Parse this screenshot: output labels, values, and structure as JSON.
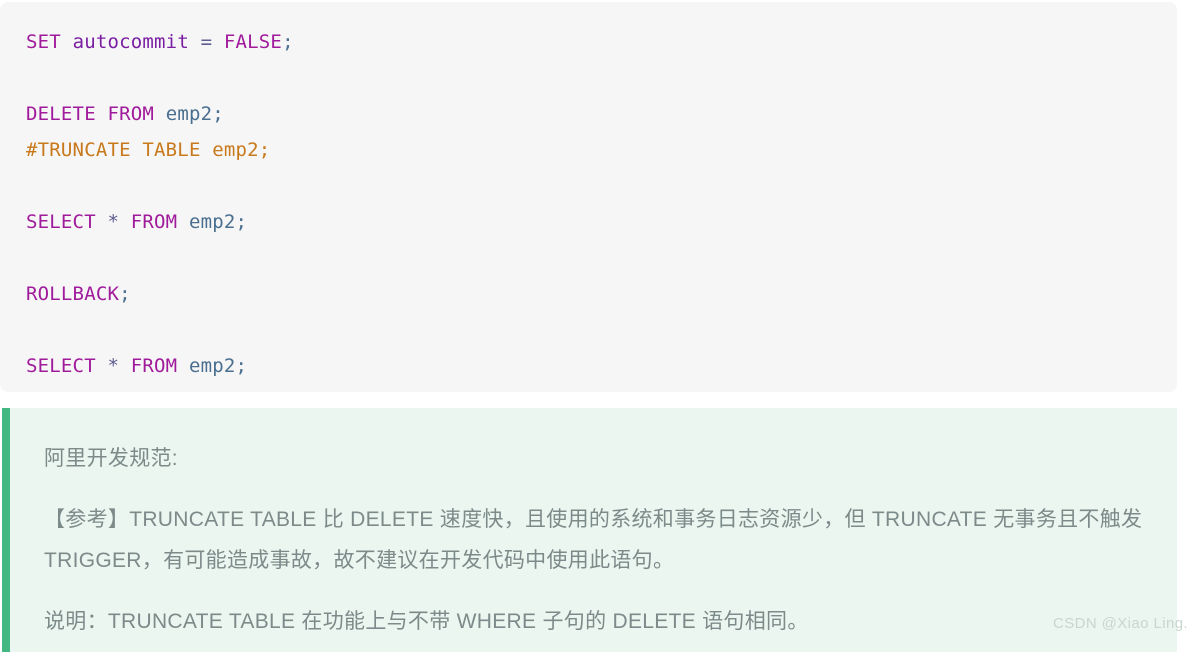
{
  "code_block": {
    "background": "#f6f6f6",
    "language": "sql",
    "lines": [
      {
        "type": "code",
        "tokens": [
          {
            "t": "SET",
            "c": "kw"
          },
          {
            "t": " ",
            "c": "plain"
          },
          {
            "t": "autocommit",
            "c": "kw2"
          },
          {
            "t": " ",
            "c": "plain"
          },
          {
            "t": "=",
            "c": "op"
          },
          {
            "t": " ",
            "c": "plain"
          },
          {
            "t": "FALSE",
            "c": "kw"
          },
          {
            "t": ";",
            "c": "punct"
          }
        ],
        "text": "SET autocommit = FALSE;"
      },
      {
        "type": "blank",
        "tokens": [],
        "text": ""
      },
      {
        "type": "code",
        "tokens": [
          {
            "t": "DELETE",
            "c": "kw"
          },
          {
            "t": " ",
            "c": "plain"
          },
          {
            "t": "FROM",
            "c": "kw"
          },
          {
            "t": " ",
            "c": "plain"
          },
          {
            "t": "emp2",
            "c": "ident"
          },
          {
            "t": ";",
            "c": "punct"
          }
        ],
        "text": "DELETE FROM emp2;"
      },
      {
        "type": "comment",
        "tokens": [
          {
            "t": "#TRUNCATE TABLE emp2;",
            "c": "comment"
          }
        ],
        "text": "#TRUNCATE TABLE emp2;"
      },
      {
        "type": "blank",
        "tokens": [],
        "text": ""
      },
      {
        "type": "code",
        "tokens": [
          {
            "t": "SELECT",
            "c": "kw"
          },
          {
            "t": " ",
            "c": "plain"
          },
          {
            "t": "*",
            "c": "op"
          },
          {
            "t": " ",
            "c": "plain"
          },
          {
            "t": "FROM",
            "c": "kw"
          },
          {
            "t": " ",
            "c": "plain"
          },
          {
            "t": "emp2",
            "c": "ident"
          },
          {
            "t": ";",
            "c": "punct"
          }
        ],
        "text": "SELECT * FROM emp2;"
      },
      {
        "type": "blank",
        "tokens": [],
        "text": ""
      },
      {
        "type": "code",
        "tokens": [
          {
            "t": "ROLLBACK",
            "c": "kw"
          },
          {
            "t": ";",
            "c": "punct"
          }
        ],
        "text": "ROLLBACK;"
      },
      {
        "type": "blank",
        "tokens": [],
        "text": ""
      },
      {
        "type": "code",
        "tokens": [
          {
            "t": "SELECT",
            "c": "kw"
          },
          {
            "t": " ",
            "c": "plain"
          },
          {
            "t": "*",
            "c": "op"
          },
          {
            "t": " ",
            "c": "plain"
          },
          {
            "t": "FROM",
            "c": "kw"
          },
          {
            "t": " ",
            "c": "plain"
          },
          {
            "t": "emp2",
            "c": "ident"
          },
          {
            "t": ";",
            "c": "punct"
          }
        ],
        "text": "SELECT * FROM emp2;"
      }
    ]
  },
  "callout": {
    "accent_color": "#44b883",
    "background": "#eaf6ef",
    "text_color": "#7d8a8a",
    "title": "阿里开发规范:",
    "body": "【参考】TRUNCATE TABLE 比 DELETE 速度快，且使用的系统和事务日志资源少，但 TRUNCATE 无事务且不触发 TRIGGER，有可能造成事故，故不建议在开发代码中使用此语句。",
    "note": "说明：TRUNCATE TABLE 在功能上与不带 WHERE 子句的 DELETE 语句相同。"
  },
  "watermark": {
    "text": "CSDN @Xiao Ling.",
    "color": "#c9d6cf"
  }
}
